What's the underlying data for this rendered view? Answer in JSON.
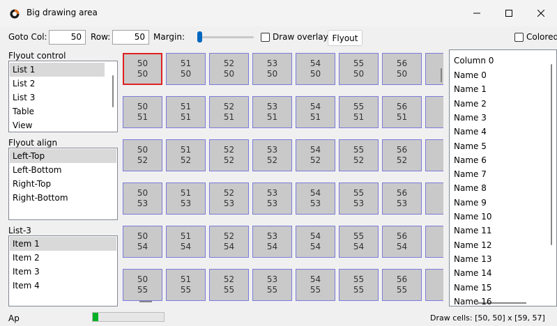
{
  "window": {
    "title": "Big drawing area",
    "icon": "app-logo-icon",
    "controls": [
      "minimize-icon",
      "maximize-icon",
      "close-icon"
    ]
  },
  "toolbar": {
    "goto_col_label": "Goto Col:",
    "goto_col_value": "50",
    "row_label": "Row:",
    "row_value": "50",
    "margin_label": "Margin:",
    "margin_value": 0.04,
    "draw_overlay_label": "Draw overlay",
    "draw_overlay_checked": false,
    "flyout_button": "Flyout",
    "colored_label": "Colored",
    "colored_checked": false
  },
  "flyout_control": {
    "label": "Flyout control",
    "items": [
      "List 1",
      "List 2",
      "List 3",
      "Table",
      "View"
    ],
    "selected": "List 1"
  },
  "flyout_align": {
    "label": "Flyout align",
    "items": [
      "Left-Top",
      "Left-Bottom",
      "Right-Top",
      "Right-Bottom"
    ],
    "selected": "Left-Top"
  },
  "list3": {
    "label": "List-3",
    "items": [
      "Item 1",
      "Item 2",
      "Item 3",
      "Item 4"
    ],
    "selected": "Item 1"
  },
  "grid": {
    "cols": [
      "50",
      "51",
      "52",
      "53",
      "54",
      "55",
      "56"
    ],
    "rows": [
      "50",
      "51",
      "52",
      "53",
      "54",
      "55"
    ],
    "active": {
      "col": "50",
      "row": "50"
    },
    "cell_color": "#c9c9c9",
    "border_color": "#7a7adc",
    "active_border_color": "#e02020"
  },
  "right_list": {
    "header": "Column 0",
    "items": [
      "Name 0",
      "Name 1",
      "Name 2",
      "Name 3",
      "Name 4",
      "Name 5",
      "Name 6",
      "Name 7",
      "Name 8",
      "Name 9",
      "Name 10",
      "Name 11",
      "Name 12",
      "Name 13",
      "Name 14",
      "Name 15",
      "Name 16"
    ]
  },
  "status": {
    "left_text": "Ap",
    "progress": 0.08,
    "progress_color": "#06b025",
    "right_text": "Draw cells: [50, 50] x [59, 57]"
  }
}
